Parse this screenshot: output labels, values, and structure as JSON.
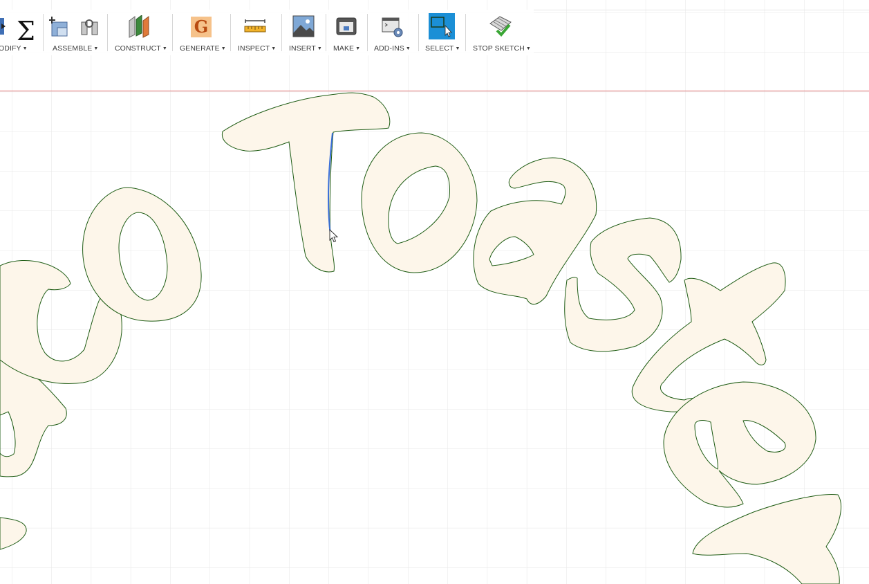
{
  "toolbar": {
    "groups": [
      {
        "id": "modify",
        "label": "ODIFY",
        "icons": [
          "modify-icon",
          "sigma-icon"
        ]
      },
      {
        "id": "assemble",
        "label": "ASSEMBLE",
        "icons": [
          "new-component-icon",
          "joint-icon"
        ]
      },
      {
        "id": "construct",
        "label": "CONSTRUCT",
        "icons": [
          "construct-plane-icon"
        ]
      },
      {
        "id": "generate",
        "label": "GENERATE",
        "icons": [
          "generative-g-icon"
        ]
      },
      {
        "id": "inspect",
        "label": "INSPECT",
        "icons": [
          "ruler-icon"
        ]
      },
      {
        "id": "insert",
        "label": "INSERT",
        "icons": [
          "image-icon"
        ]
      },
      {
        "id": "make",
        "label": "MAKE",
        "icons": [
          "printer-icon"
        ]
      },
      {
        "id": "add_ins",
        "label": "ADD-INS",
        "icons": [
          "scripts-gear-icon"
        ]
      },
      {
        "id": "select",
        "label": "SELECT",
        "icons": [
          "window-select-icon"
        ]
      },
      {
        "id": "stop_sketch",
        "label": "STOP SKETCH",
        "icons": [
          "finish-sketch-check-icon"
        ]
      }
    ],
    "caret": "▼",
    "sigma": "Σ",
    "generate_letter": "G"
  },
  "sketch": {
    "letters_arc1": [
      "c",
      "o",
      "T",
      "o",
      "a",
      "s",
      "t",
      "e",
      "r"
    ],
    "fill_color": "#fdf6ea",
    "outline_color": "#1e5c14",
    "selection_color": "#3a6fd8",
    "axis_color": "#e06060",
    "grid_color": "#e8e8e8"
  }
}
